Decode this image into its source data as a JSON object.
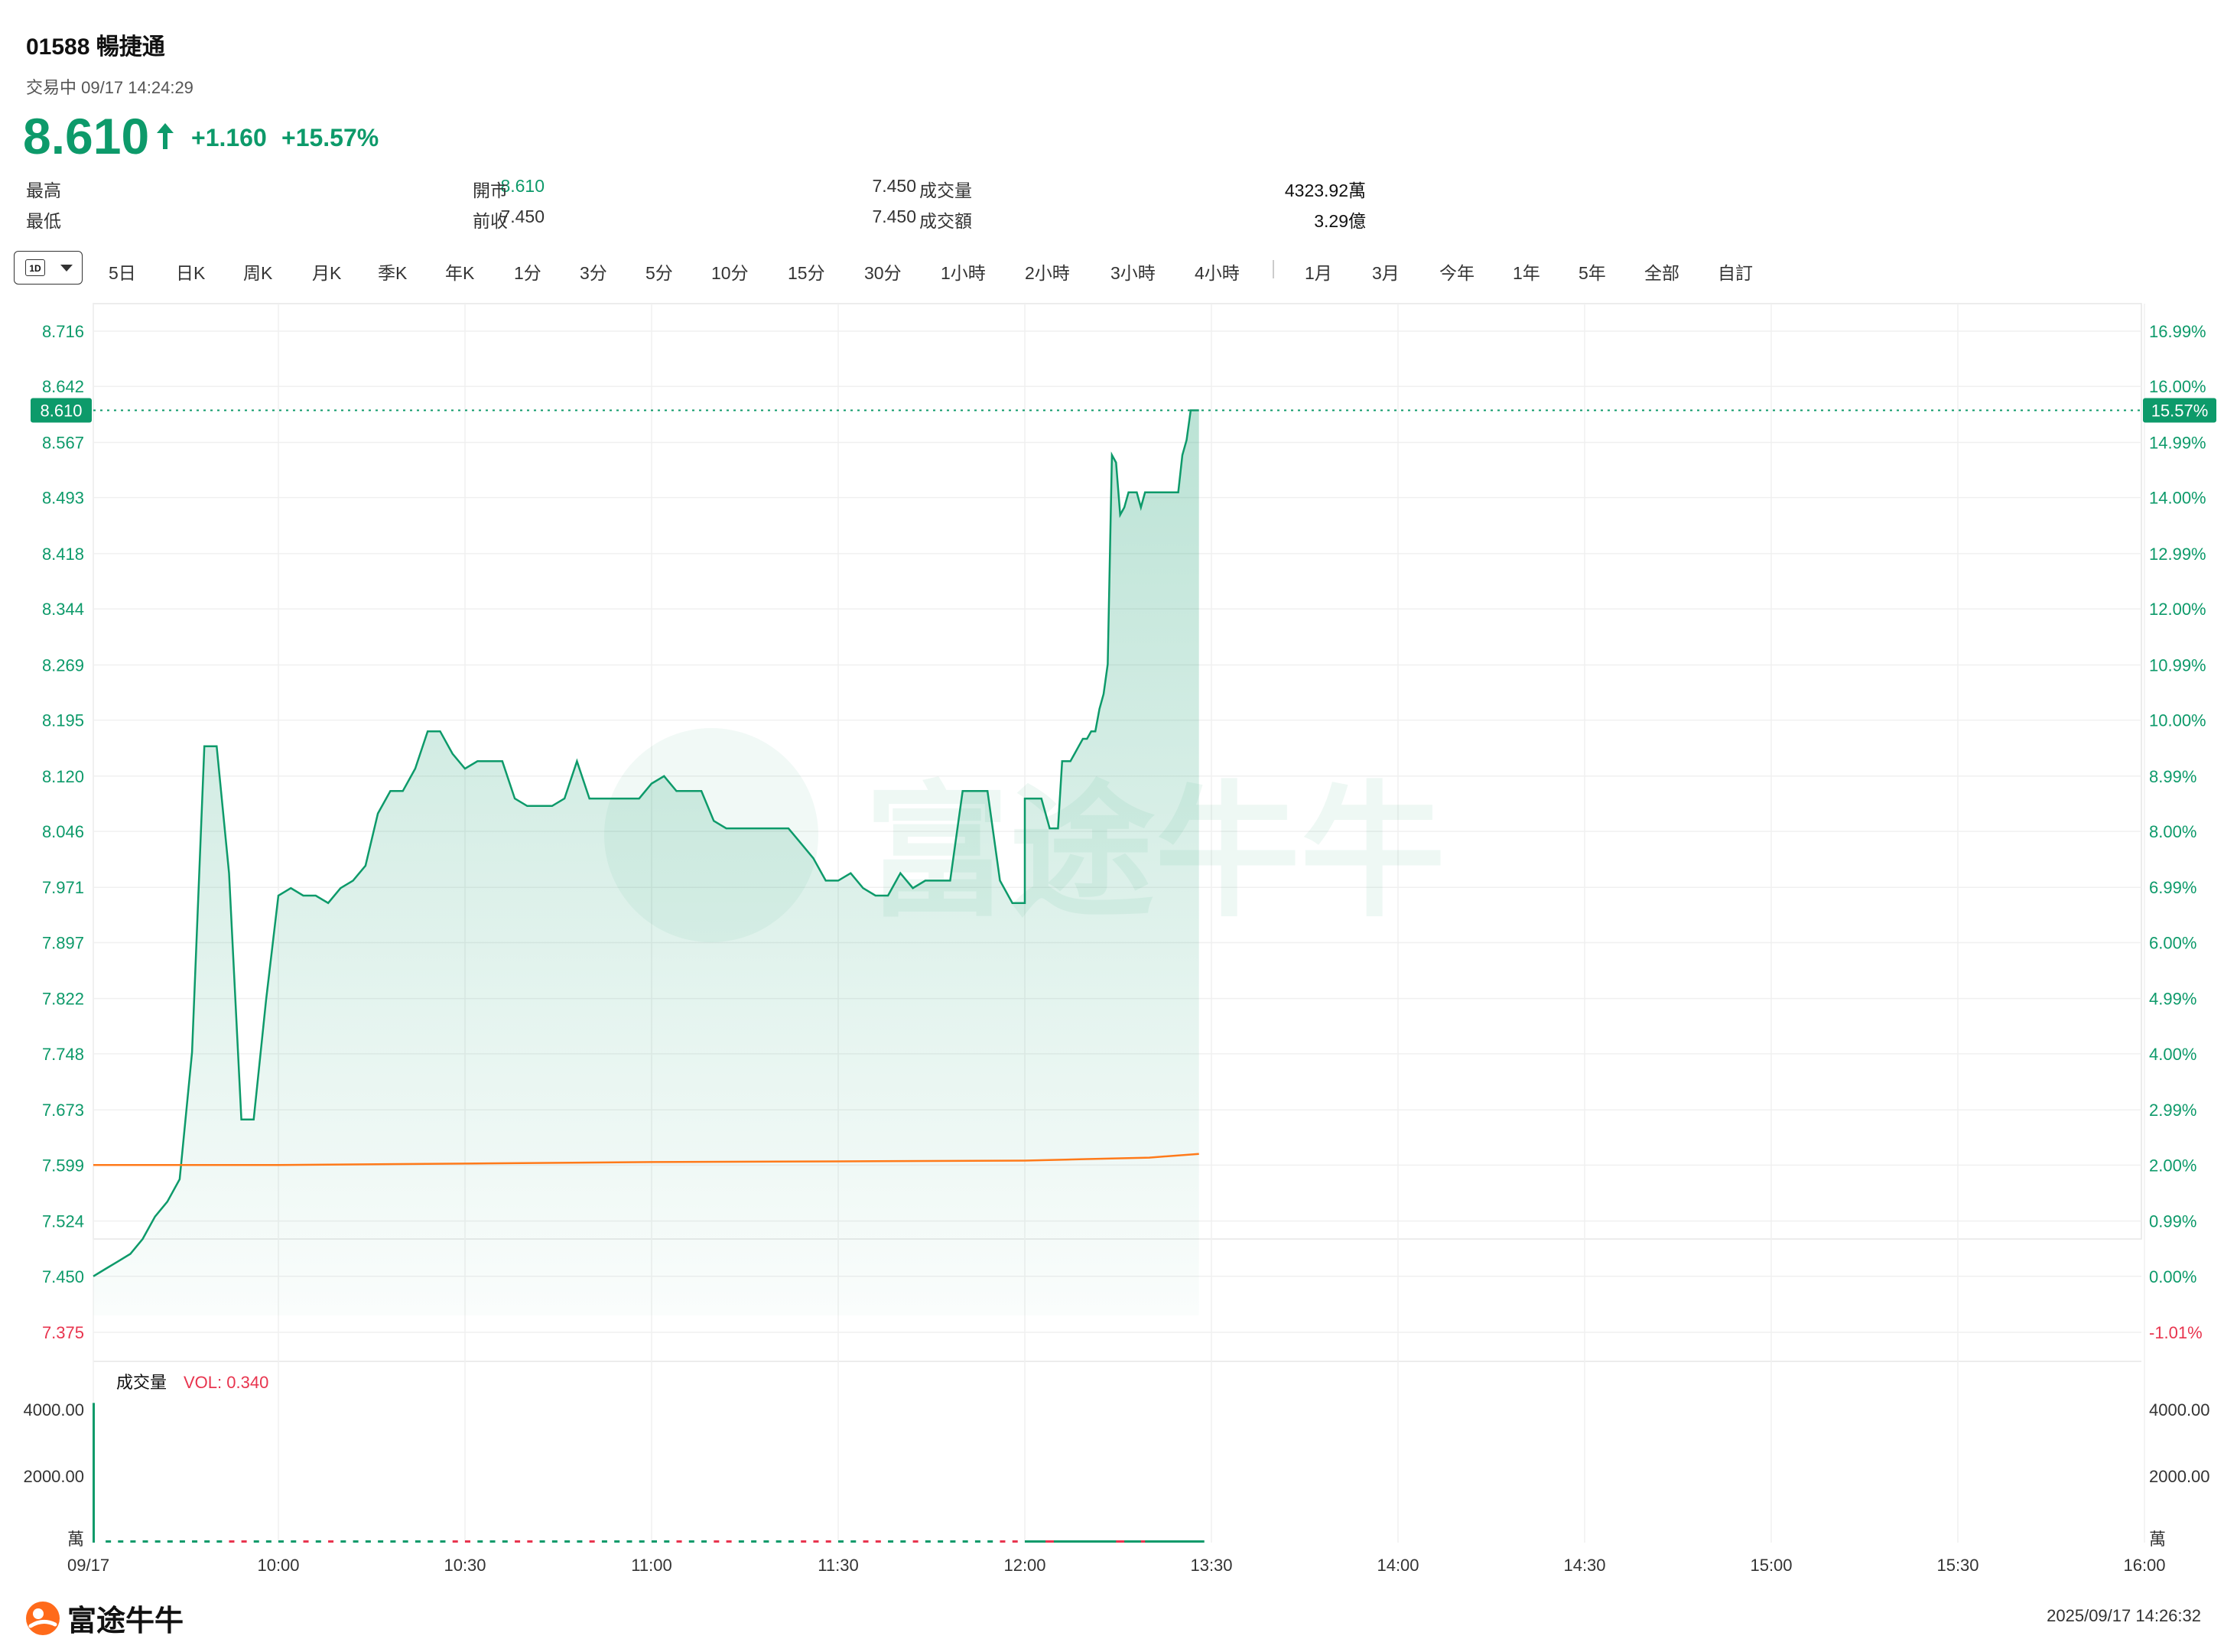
{
  "header": {
    "title": "01588  暢捷通",
    "subtitle": "交易中 09/17 14:24:29",
    "price": "8.610",
    "change": "+1.160",
    "change_pct": "+15.57%",
    "up_color": "#0d9a6a"
  },
  "stats": [
    {
      "label": "最高",
      "value": "8.610",
      "color": "#0d9a6a"
    },
    {
      "label": "最低",
      "value": "7.450",
      "color": "#333333"
    },
    {
      "label": "開市",
      "value": "7.450",
      "color": "#333333"
    },
    {
      "label": "前收",
      "value": "7.450",
      "color": "#333333"
    },
    {
      "label": "成交量",
      "value": "4323.92萬",
      "color": "#111111"
    },
    {
      "label": "成交額",
      "value": "3.29億",
      "color": "#111111"
    }
  ],
  "tabs": {
    "active": "1D",
    "items": [
      "5日",
      "日K",
      "周K",
      "月K",
      "季K",
      "年K",
      "1分",
      "3分",
      "5分",
      "10分",
      "15分",
      "30分",
      "1小時",
      "2小時",
      "3小時",
      "4小時",
      "1月",
      "3月",
      "今年",
      "1年",
      "5年",
      "全部",
      "自訂"
    ]
  },
  "chart_data": {
    "type": "line",
    "title": "",
    "watermark": "富途牛牛",
    "x_ticks": [
      "09/17",
      "10:00",
      "10:30",
      "11:00",
      "11:30",
      "12:00",
      "13:30",
      "14:00",
      "14:30",
      "15:00",
      "15:30",
      "16:00"
    ],
    "y_ticks_left": [
      "8.716",
      "8.642",
      "8.567",
      "8.493",
      "8.418",
      "8.344",
      "8.269",
      "8.195",
      "8.120",
      "8.046",
      "7.971",
      "7.897",
      "7.822",
      "7.748",
      "7.673",
      "7.599",
      "7.524",
      "7.450",
      "7.375"
    ],
    "y_ticks_right": [
      "16.99%",
      "16.00%",
      "14.99%",
      "14.00%",
      "12.99%",
      "12.00%",
      "10.99%",
      "10.00%",
      "8.99%",
      "8.00%",
      "6.99%",
      "6.00%",
      "4.99%",
      "4.00%",
      "2.99%",
      "2.00%",
      "0.99%",
      "0.00%",
      "-1.01%"
    ],
    "ylim": [
      7.375,
      8.716
    ],
    "prev_close": 7.45,
    "current_price_label": "8.610",
    "current_pct_label": "15.57%",
    "price_color": "#0d9a6a",
    "avg_color": "#ff7a1a",
    "down_color": "#e8344e",
    "series": [
      {
        "name": "price",
        "x": [
          "09:30",
          "09:32",
          "09:34",
          "09:36",
          "09:38",
          "09:40",
          "09:42",
          "09:44",
          "09:46",
          "09:48",
          "09:50",
          "09:52",
          "09:54",
          "09:56",
          "09:58",
          "10:00",
          "10:02",
          "10:04",
          "10:06",
          "10:08",
          "10:10",
          "10:12",
          "10:14",
          "10:16",
          "10:18",
          "10:20",
          "10:22",
          "10:24",
          "10:26",
          "10:28",
          "10:30",
          "10:32",
          "10:34",
          "10:36",
          "10:38",
          "10:40",
          "10:42",
          "10:44",
          "10:46",
          "10:48",
          "10:50",
          "10:52",
          "10:54",
          "10:56",
          "10:58",
          "11:00",
          "11:02",
          "11:04",
          "11:06",
          "11:08",
          "11:10",
          "11:12",
          "11:14",
          "11:16",
          "11:18",
          "11:20",
          "11:22",
          "11:24",
          "11:26",
          "11:28",
          "11:30",
          "11:32",
          "11:34",
          "11:36",
          "11:38",
          "11:40",
          "11:42",
          "11:44",
          "11:46",
          "11:48",
          "11:50",
          "11:52",
          "11:54",
          "11:56",
          "11:58",
          "12:00",
          "13:00",
          "13:02",
          "13:04",
          "13:06",
          "13:08",
          "13:10",
          "13:12",
          "13:14",
          "13:16",
          "13:18",
          "13:20",
          "13:22",
          "13:24",
          "13:26",
          "13:28",
          "13:30",
          "13:32",
          "13:34",
          "13:36",
          "13:38",
          "13:40",
          "13:42",
          "13:44",
          "13:46",
          "13:48",
          "13:50",
          "13:52",
          "13:54",
          "13:56",
          "13:58",
          "14:00",
          "14:02",
          "14:04",
          "14:06",
          "14:08",
          "14:10",
          "14:12",
          "14:14",
          "14:16",
          "14:18",
          "14:20",
          "14:22",
          "14:24"
        ],
        "values": [
          7.45,
          7.46,
          7.47,
          7.48,
          7.5,
          7.53,
          7.55,
          7.58,
          7.75,
          8.16,
          8.16,
          7.99,
          7.66,
          7.66,
          7.82,
          7.96,
          7.97,
          7.96,
          7.96,
          7.95,
          7.97,
          7.98,
          8.0,
          8.07,
          8.1,
          8.1,
          8.13,
          8.18,
          8.18,
          8.15,
          8.13,
          8.14,
          8.14,
          8.14,
          8.09,
          8.08,
          8.08,
          8.08,
          8.09,
          8.14,
          8.09,
          8.09,
          8.09,
          8.09,
          8.09,
          8.11,
          8.12,
          8.1,
          8.1,
          8.1,
          8.06,
          8.05,
          8.05,
          8.05,
          8.05,
          8.05,
          8.05,
          8.03,
          8.01,
          7.98,
          7.98,
          7.99,
          7.97,
          7.96,
          7.96,
          7.99,
          7.97,
          7.98,
          7.98,
          7.98,
          8.1,
          8.1,
          8.1,
          7.98,
          7.95,
          7.95,
          8.09,
          8.09,
          8.09,
          8.09,
          8.09,
          8.07,
          8.05,
          8.05,
          8.05,
          8.14,
          8.14,
          8.14,
          8.15,
          8.16,
          8.17,
          8.17,
          8.18,
          8.18,
          8.21,
          8.23,
          8.27,
          8.55,
          8.54,
          8.47,
          8.48,
          8.5,
          8.5,
          8.5,
          8.48,
          8.5,
          8.5,
          8.5,
          8.5,
          8.5,
          8.5,
          8.5,
          8.5,
          8.5,
          8.55,
          8.57,
          8.61,
          8.61,
          8.61
        ]
      },
      {
        "name": "avg",
        "x": [
          "09:30",
          "10:00",
          "10:30",
          "11:00",
          "11:30",
          "12:00",
          "13:30",
          "14:00",
          "14:24"
        ],
        "values": [
          7.599,
          7.599,
          7.601,
          7.603,
          7.604,
          7.605,
          7.607,
          7.609,
          7.614
        ]
      }
    ],
    "volume": {
      "label": "成交量",
      "vol_label": "VOL: 0.340",
      "y_ticks": [
        "4000.00",
        "2000.00",
        "萬"
      ],
      "ylim": [
        0,
        4300
      ],
      "first_bar": 4200,
      "unit": "萬"
    }
  },
  "footer": {
    "brand": "富途牛牛",
    "timestamp": "2025/09/17 14:26:32"
  }
}
